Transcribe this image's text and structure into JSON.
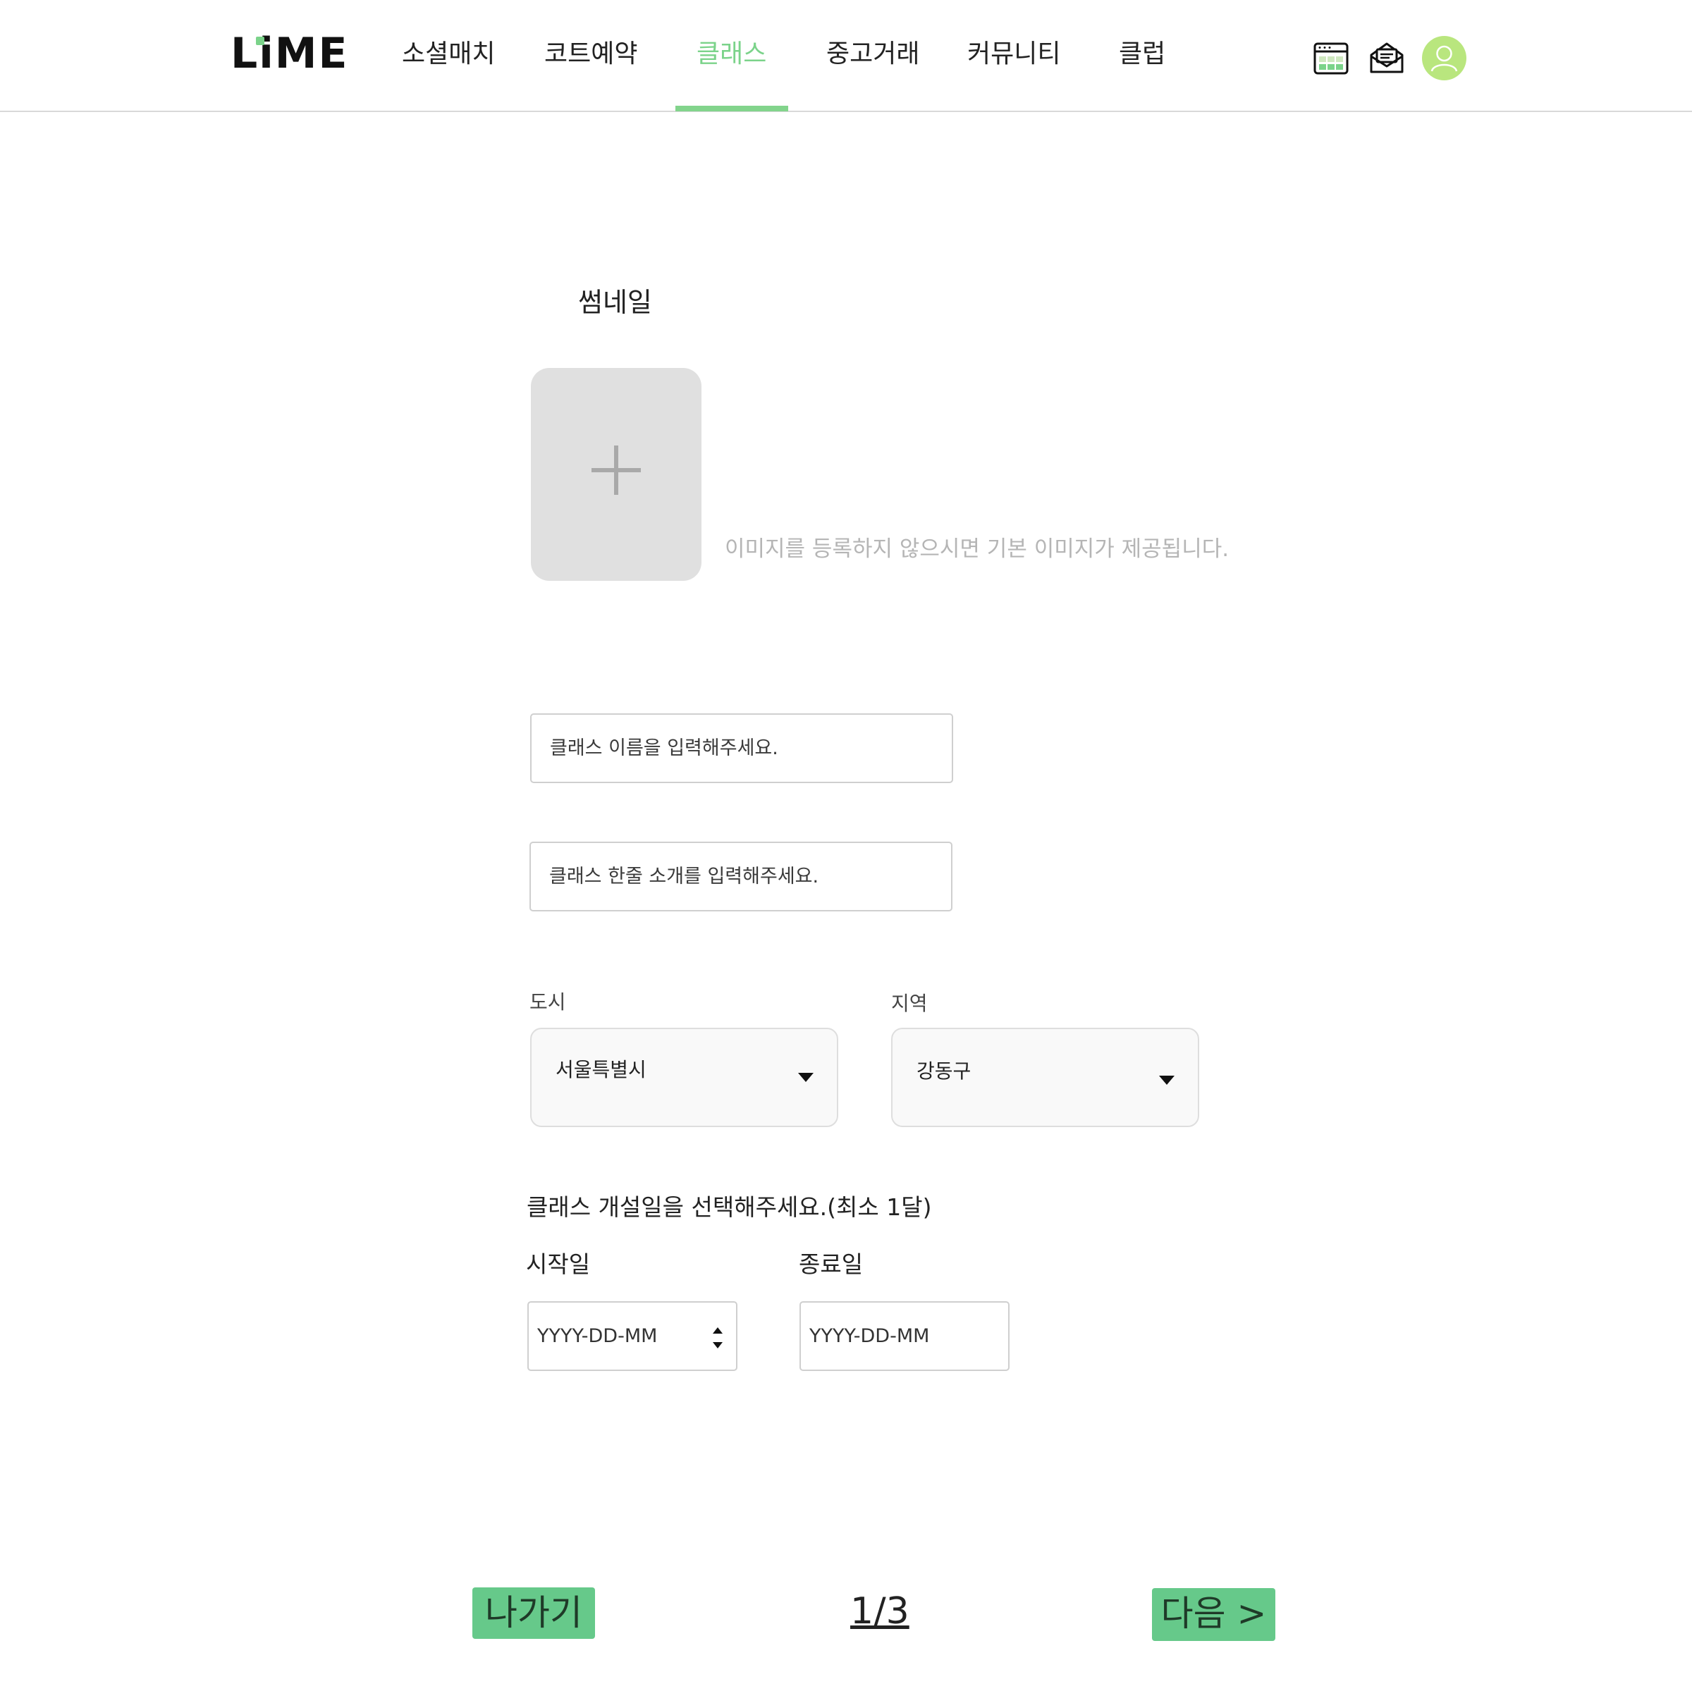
{
  "header": {
    "logo": "LiME",
    "nav": [
      "소셜매치",
      "코트예약",
      "클래스",
      "중고거래",
      "커뮤니티",
      "클럽"
    ],
    "active_nav": "클래스",
    "icons": [
      "calendar-icon",
      "mail-icon",
      "user-avatar-icon"
    ],
    "accent_color": "#82d48c"
  },
  "thumbnail": {
    "label": "썸네일",
    "add_icon": "plus-icon",
    "hint": "이미지를 등록하지 않으시면 기본 이미지가 제공됩니다."
  },
  "form": {
    "name_placeholder": "클래스 이름을 입력해주세요.",
    "intro_placeholder": "클래스 한줄 소개를 입력해주세요.",
    "city": {
      "label": "도시",
      "value": "서울특별시"
    },
    "district": {
      "label": "지역",
      "value": "강동구"
    },
    "period": {
      "label": "클래스 개설일을 선택해주세요.(최소 1달)",
      "start_label": "시작일",
      "start_value": "YYYY-DD-MM",
      "end_label": "종료일",
      "end_value": "YYYY-DD-MM"
    }
  },
  "footer": {
    "exit_label": "나가기",
    "page": "1/3",
    "next_label": "다음 >",
    "button_color": "#66c98a"
  }
}
